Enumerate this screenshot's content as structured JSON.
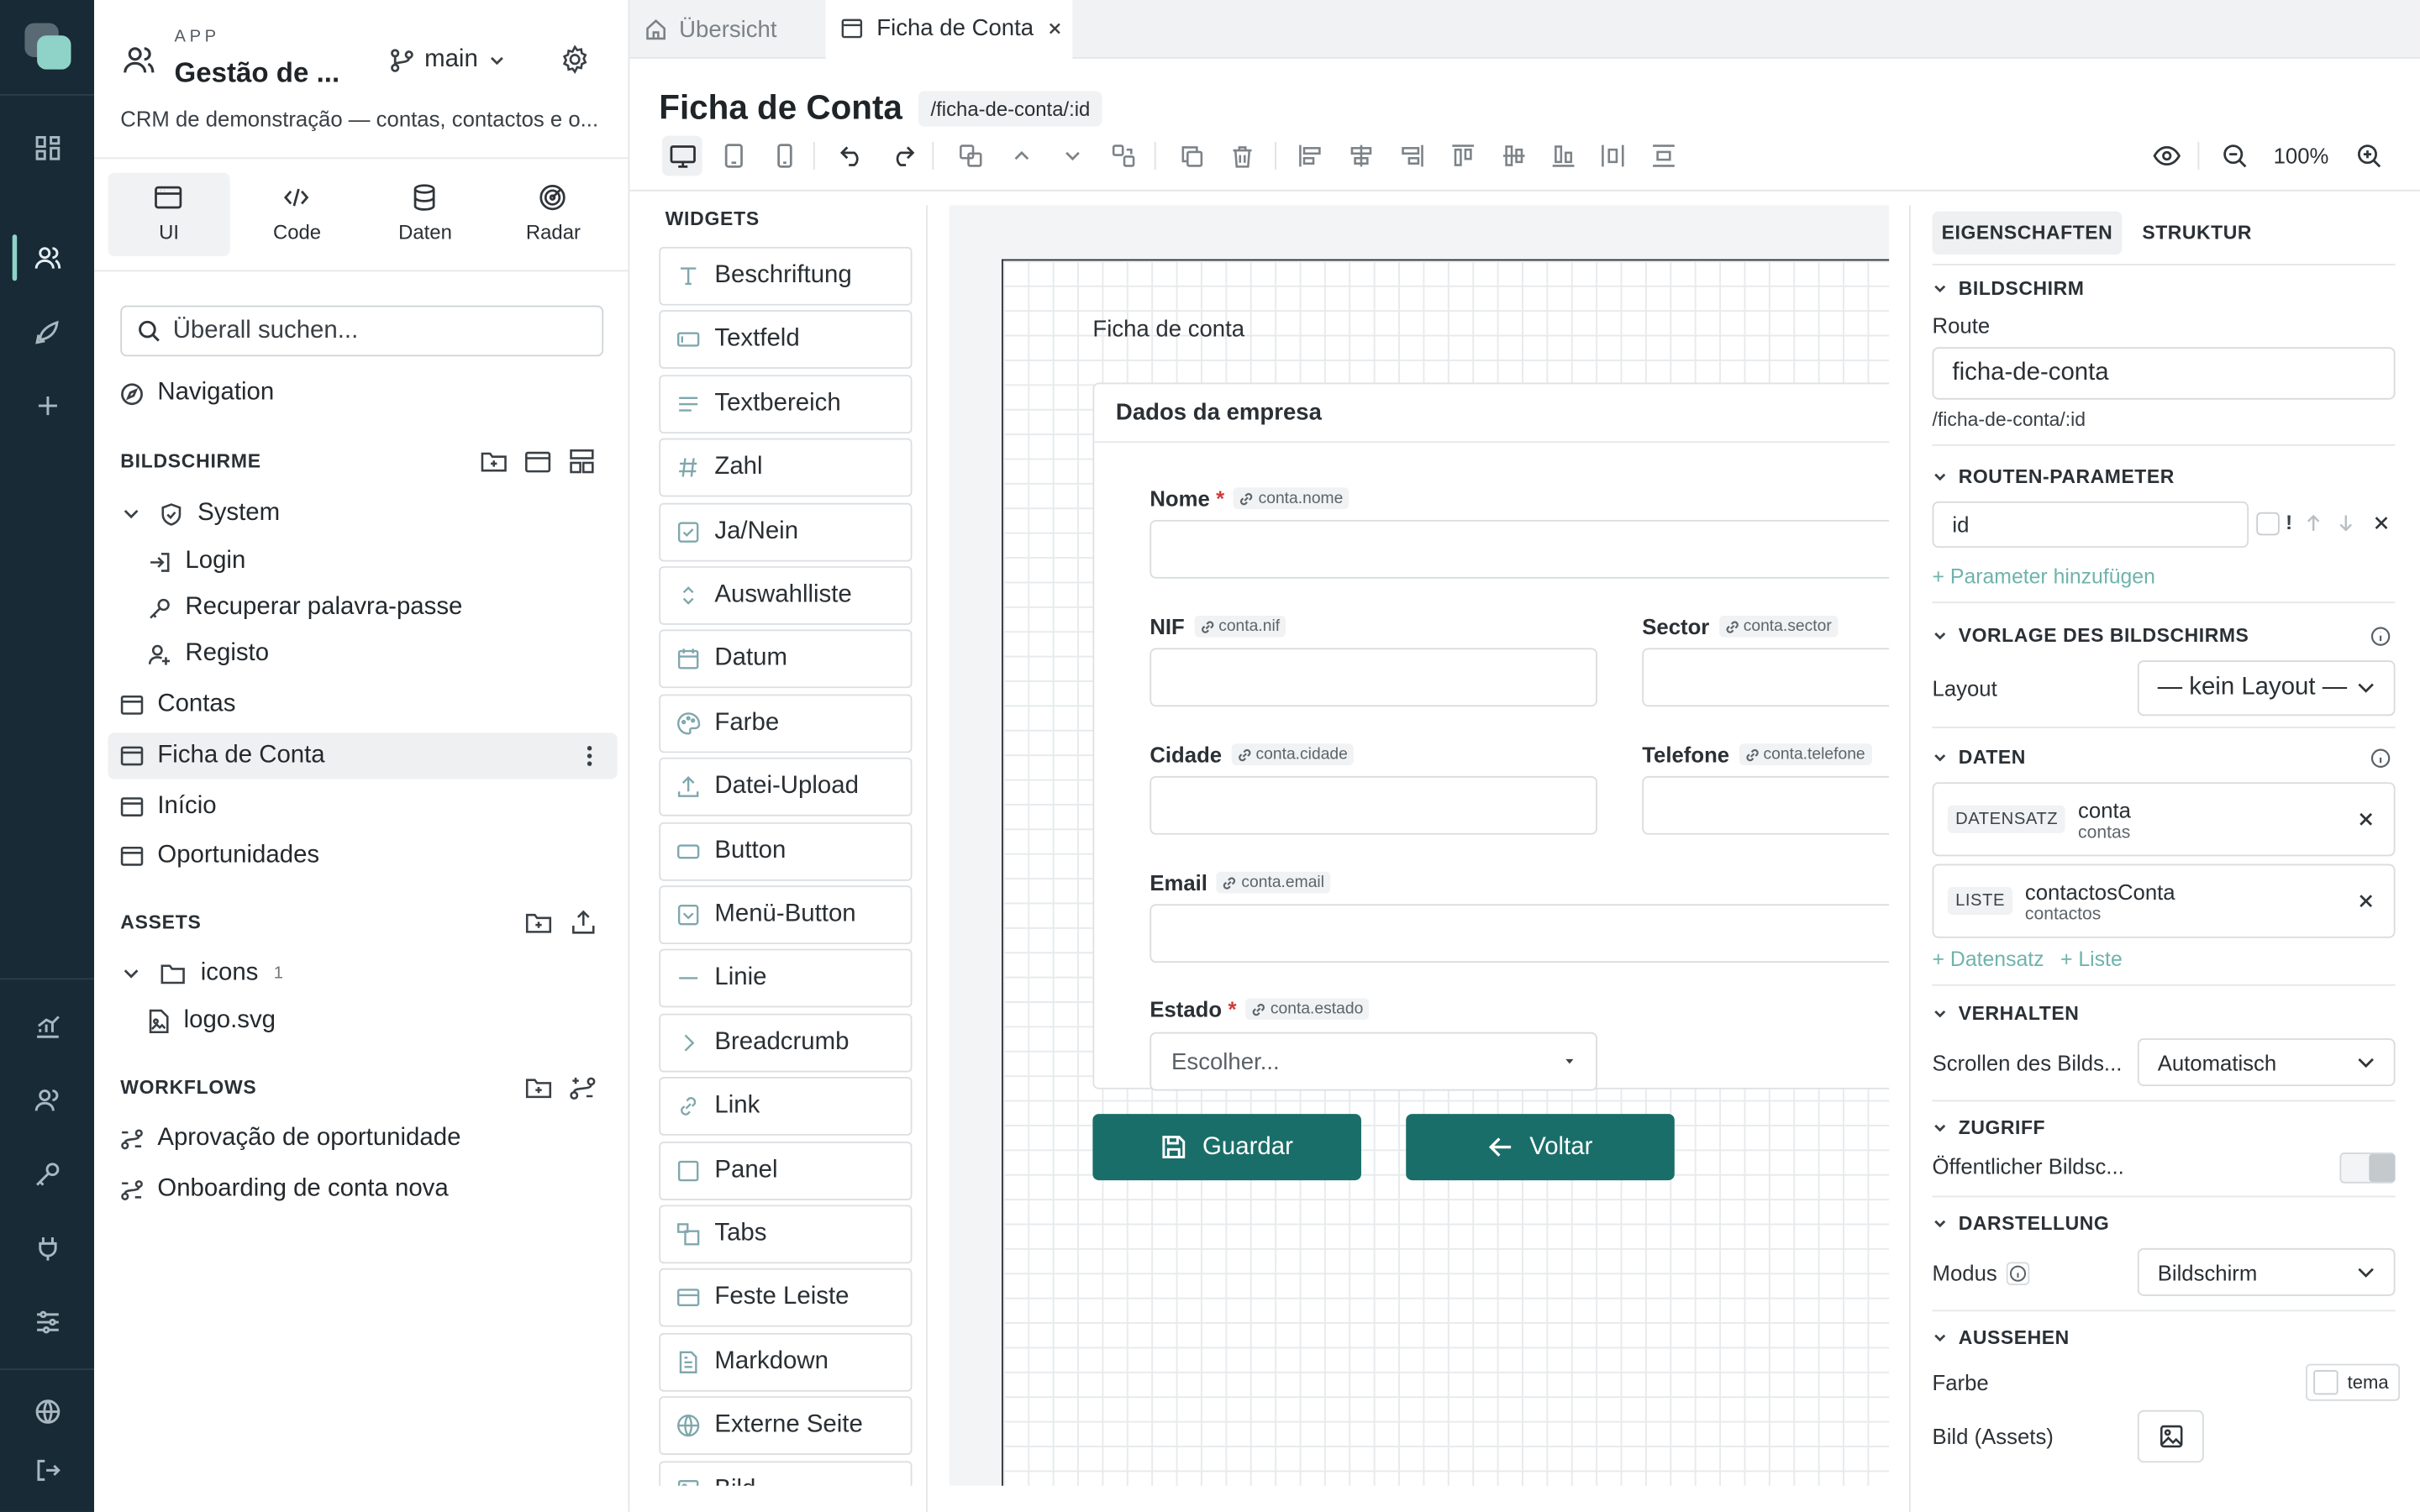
{
  "app": {
    "kicker": "APP",
    "title": "Gestão de ...",
    "branch": "main",
    "description": "CRM de demonstração — contas, contactos e o..."
  },
  "modes": [
    {
      "label": "UI"
    },
    {
      "label": "Code"
    },
    {
      "label": "Daten"
    },
    {
      "label": "Radar"
    }
  ],
  "search": {
    "placeholder": "Überall suchen..."
  },
  "navigation_label": "Navigation",
  "screens": {
    "header": "BILDSCHIRME",
    "system_folder": "System",
    "system_items": [
      "Login",
      "Recuperar palavra-passe",
      "Registo"
    ],
    "items": [
      "Contas",
      "Ficha de Conta",
      "Início",
      "Oportunidades"
    ]
  },
  "assets": {
    "header": "ASSETS",
    "folder": "icons",
    "folder_count": "1",
    "file": "logo.svg"
  },
  "workflows": {
    "header": "WORKFLOWS",
    "items": [
      "Aprovação de oportunidade",
      "Onboarding de conta nova"
    ]
  },
  "tabs": [
    {
      "label": "Übersicht"
    },
    {
      "label": "Ficha de Conta"
    }
  ],
  "page": {
    "title": "Ficha de Conta",
    "route_badge": "/ficha-de-conta/:id"
  },
  "toolbar": {
    "zoom": "100%"
  },
  "widgets": {
    "header": "WIDGETS",
    "items": [
      {
        "label": "Beschriftung",
        "icon": "text-icon"
      },
      {
        "label": "Textfeld",
        "icon": "input-icon"
      },
      {
        "label": "Textbereich",
        "icon": "textarea-icon"
      },
      {
        "label": "Zahl",
        "icon": "hash-icon"
      },
      {
        "label": "Ja/Nein",
        "icon": "checkbox-icon"
      },
      {
        "label": "Auswahlliste",
        "icon": "select-icon"
      },
      {
        "label": "Datum",
        "icon": "calendar-icon"
      },
      {
        "label": "Farbe",
        "icon": "palette-icon"
      },
      {
        "label": "Datei-Upload",
        "icon": "upload-icon"
      },
      {
        "label": "Button",
        "icon": "button-icon"
      },
      {
        "label": "Menü-Button",
        "icon": "menu-button-icon"
      },
      {
        "label": "Linie",
        "icon": "line-icon"
      },
      {
        "label": "Breadcrumb",
        "icon": "chevron-right-icon"
      },
      {
        "label": "Link",
        "icon": "link-icon"
      },
      {
        "label": "Panel",
        "icon": "panel-icon"
      },
      {
        "label": "Tabs",
        "icon": "tabs-icon"
      },
      {
        "label": "Feste Leiste",
        "icon": "fixed-bar-icon"
      },
      {
        "label": "Markdown",
        "icon": "markdown-icon"
      },
      {
        "label": "Externe Seite",
        "icon": "globe-icon"
      },
      {
        "label": "Bild",
        "icon": "image-icon"
      }
    ]
  },
  "form": {
    "screen_title": "Ficha de conta",
    "panel_title": "Dados da empresa",
    "fields": {
      "nome": {
        "label": "Nome",
        "binding": "conta.nome"
      },
      "nif": {
        "label": "NIF",
        "binding": "conta.nif"
      },
      "sector": {
        "label": "Sector",
        "binding": "conta.sector"
      },
      "cidade": {
        "label": "Cidade",
        "binding": "conta.cidade"
      },
      "telefone": {
        "label": "Telefone",
        "binding": "conta.telefone"
      },
      "email": {
        "label": "Email",
        "binding": "conta.email"
      },
      "estado": {
        "label": "Estado",
        "binding": "conta.estado",
        "placeholder": "Escolher..."
      }
    },
    "required_mark": "*",
    "save": "Guardar",
    "back": "Voltar"
  },
  "props": {
    "tabs": [
      "EIGENSCHAFTEN",
      "STRUKTUR"
    ],
    "screen": {
      "header": "BILDSCHIRM",
      "route_label": "Route",
      "route_value": "ficha-de-conta",
      "route_hint": "/ficha-de-conta/:id"
    },
    "route_params": {
      "header": "ROUTEN-PARAMETER",
      "param": "id",
      "required_mark": "!",
      "add": "+ Parameter hinzufügen"
    },
    "template": {
      "header": "VORLAGE DES BILDSCHIRMS",
      "layout_label": "Layout",
      "layout_value": "— kein Layout —"
    },
    "data": {
      "header": "DATEN",
      "items": [
        {
          "tag": "DATENSATZ",
          "name": "conta",
          "source": "contas"
        },
        {
          "tag": "LISTE",
          "name": "contactosConta",
          "source": "contactos"
        }
      ],
      "add_record": "+ Datensatz",
      "add_list": "+ Liste"
    },
    "behavior": {
      "header": "VERHALTEN",
      "scroll_label": "Scrollen des Bilds...",
      "scroll_value": "Automatisch"
    },
    "access": {
      "header": "ZUGRIFF",
      "public_label": "Öffentlicher Bildsc..."
    },
    "display": {
      "header": "DARSTELLUNG",
      "mode_label": "Modus",
      "mode_value": "Bildschirm"
    },
    "appearance": {
      "header": "AUSSEHEN",
      "color_label": "Farbe",
      "color_value": "tema",
      "image_label": "Bild (Assets)"
    }
  },
  "colors": {
    "rail": "#172a36",
    "primary": "#1a6e69",
    "accent": "#6fb3ac"
  }
}
